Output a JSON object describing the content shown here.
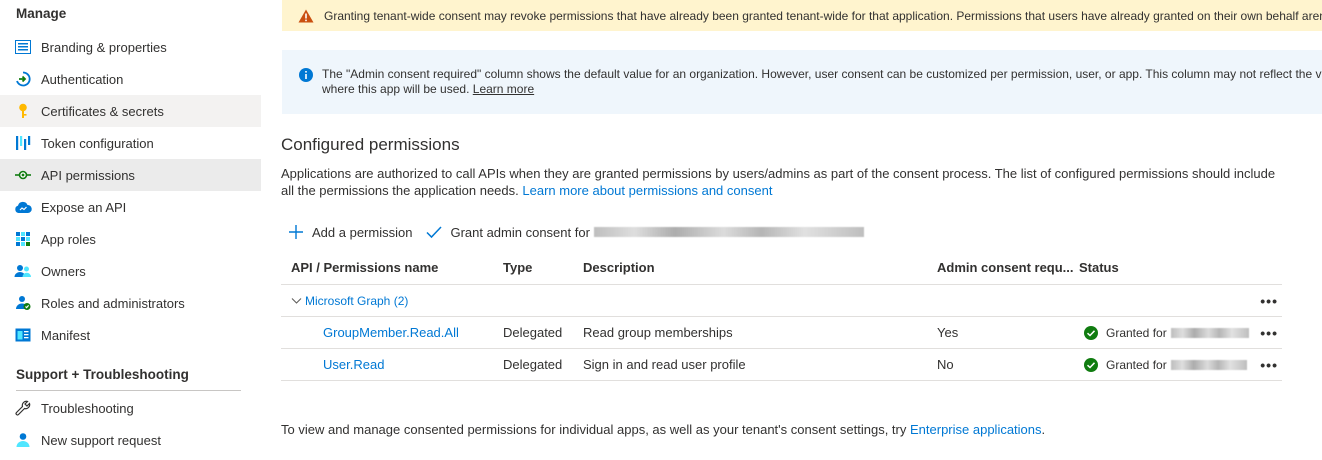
{
  "sidebar": {
    "sections": [
      {
        "title": "Manage"
      },
      {
        "title": "Support + Troubleshooting"
      }
    ],
    "manage_items": [
      {
        "label": "Branding & properties",
        "icon": "branding-icon"
      },
      {
        "label": "Authentication",
        "icon": "authentication-icon"
      },
      {
        "label": "Certificates & secrets",
        "icon": "key-icon"
      },
      {
        "label": "Token configuration",
        "icon": "token-icon"
      },
      {
        "label": "API permissions",
        "icon": "api-permissions-icon"
      },
      {
        "label": "Expose an API",
        "icon": "cloud-icon"
      },
      {
        "label": "App roles",
        "icon": "app-roles-icon"
      },
      {
        "label": "Owners",
        "icon": "owners-icon"
      },
      {
        "label": "Roles and administrators",
        "icon": "roles-icon"
      },
      {
        "label": "Manifest",
        "icon": "manifest-icon"
      }
    ],
    "support_items": [
      {
        "label": "Troubleshooting",
        "icon": "wrench-icon"
      },
      {
        "label": "New support request",
        "icon": "support-person-icon"
      }
    ]
  },
  "banners": {
    "warning": "Granting tenant-wide consent may revoke permissions that have already been granted tenant-wide for that application. Permissions that users have already granted on their own behalf aren",
    "info_line1": "The \"Admin consent required\" column shows the default value for an organization. However, user consent can be customized per permission, user, or app. This column may not reflect the va",
    "info_line2": "where this app will be used.",
    "info_link": "Learn more"
  },
  "configured": {
    "title": "Configured permissions",
    "description": "Applications are authorized to call APIs when they are granted permissions by users/admins as part of the consent process. The list of configured permissions should include all the permissions the application needs.",
    "description_link": "Learn more about permissions and consent"
  },
  "toolbar": {
    "add_label": "Add a permission",
    "grant_label": "Grant admin consent for"
  },
  "table": {
    "headers": {
      "name": "API / Permissions name",
      "type": "Type",
      "description": "Description",
      "admin": "Admin consent requ...",
      "status": "Status"
    },
    "group": "Microsoft Graph (2)",
    "rows": [
      {
        "name": "GroupMember.Read.All",
        "type": "Delegated",
        "description": "Read group memberships",
        "admin": "Yes",
        "status": "Granted for"
      },
      {
        "name": "User.Read",
        "type": "Delegated",
        "description": "Sign in and read user profile",
        "admin": "No",
        "status": "Granted for"
      }
    ],
    "more_glyph": "•••"
  },
  "footer": {
    "text": "To view and manage consented permissions for individual apps, as well as your tenant's consent settings, try",
    "link": "Enterprise applications",
    "end": "."
  },
  "colors": {
    "accent": "#0078d4",
    "warning_bg": "#fff4ce",
    "info_bg": "#eff6fc",
    "success": "#107c10"
  }
}
